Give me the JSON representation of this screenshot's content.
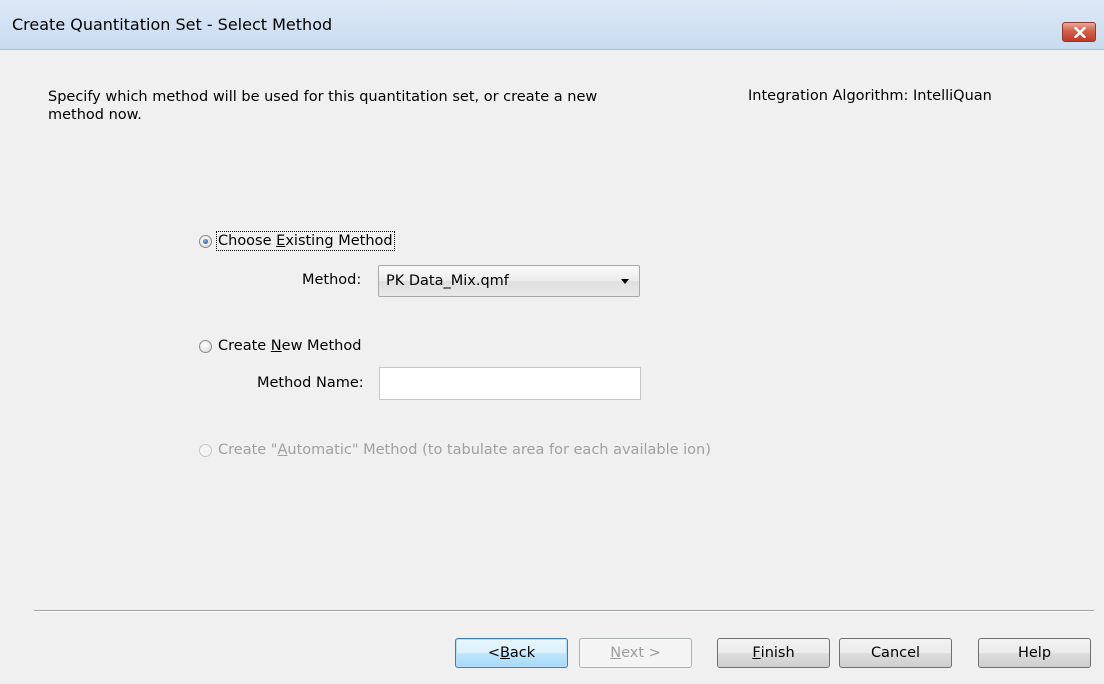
{
  "window": {
    "title": "Create Quantitation Set - Select Method"
  },
  "content": {
    "description": "Specify which method will be used for this quantitation set, or create a new method now.",
    "algorithm": "Integration Algorithm: IntelliQuan"
  },
  "options": {
    "choose_existing": {
      "label_pre": "Choose ",
      "label_key": "E",
      "label_post": "xisting Method",
      "checked": true
    },
    "method_label": "Method:",
    "method_value": "PK Data_Mix.qmf",
    "create_new": {
      "label_pre": "Create ",
      "label_key": "N",
      "label_post": "ew Method",
      "checked": false
    },
    "method_name_label": "Method Name:",
    "method_name_value": "",
    "automatic": {
      "label_pre": "Create \"",
      "label_key": "A",
      "label_post": "utomatic\" Method (to tabulate area for each available ion)",
      "enabled": false
    }
  },
  "buttons": {
    "back_pre": "< ",
    "back_key": "B",
    "back_post": "ack",
    "next_key": "N",
    "next_post": "ext >",
    "finish_key": "F",
    "finish_post": "inish",
    "cancel": "Cancel",
    "help": "Help"
  },
  "colors": {
    "title_bar": "#c9dbef",
    "close_button": "#c0392b",
    "dialog_bg": "#f0f0f0",
    "radio_selected": "#2a66b3"
  },
  "icons": {
    "close": "close-x-icon",
    "combo_arrow": "dropdown-arrow-icon"
  }
}
